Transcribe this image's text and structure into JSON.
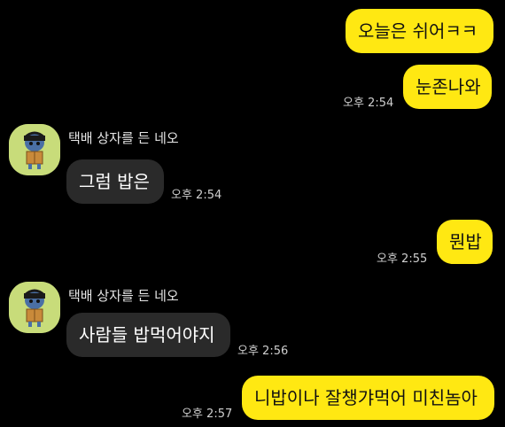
{
  "theme": {
    "background": "#000000",
    "my_bubble_color": "#ffe812",
    "their_bubble_color": "#2a2a2a",
    "avatar_background": "#c8dc7a"
  },
  "messages": [
    {
      "sender": "me",
      "text": "오늘은 쉬어ㅋㅋ",
      "time": ""
    },
    {
      "sender": "me",
      "text": "눈존나와",
      "time": "오후 2:54"
    },
    {
      "sender": "other",
      "name": "택배 상자를 든 네오",
      "avatar": "neo-with-box-avatar",
      "text": "그럼 밥은",
      "time": "오후 2:54"
    },
    {
      "sender": "me",
      "text": "뭔밥",
      "time": "오후 2:55"
    },
    {
      "sender": "other",
      "name": "택배 상자를 든 네오",
      "avatar": "neo-with-box-avatar",
      "text": "사람들 밥먹어야지",
      "time": "오후 2:56"
    },
    {
      "sender": "me",
      "text": "니밥이나 잘챙갸먹어 미친놈아",
      "time": "오후 2:57"
    }
  ]
}
